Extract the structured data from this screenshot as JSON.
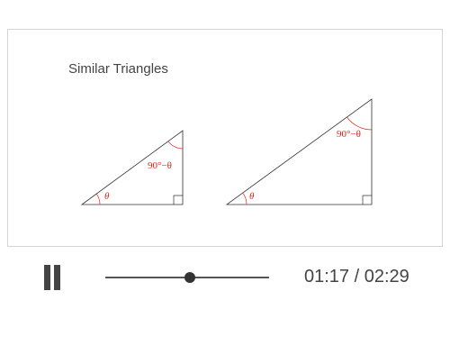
{
  "video": {
    "title": "Similar Triangles",
    "triangles": [
      {
        "theta_label": "θ",
        "complement_label": "90°−θ"
      },
      {
        "theta_label": "θ",
        "complement_label": "90°−θ"
      }
    ]
  },
  "player": {
    "state": "playing",
    "current_time": "01:17",
    "separator": "/",
    "duration": "02:29",
    "time_display": "01:17 / 02:29",
    "progress_fraction": 0.517
  },
  "colors": {
    "angle_label": "#e0251b",
    "stroke": "#333333",
    "text": "#444444"
  },
  "icons": {
    "pause": "pause-icon",
    "seek_thumb": "seek-thumb"
  }
}
